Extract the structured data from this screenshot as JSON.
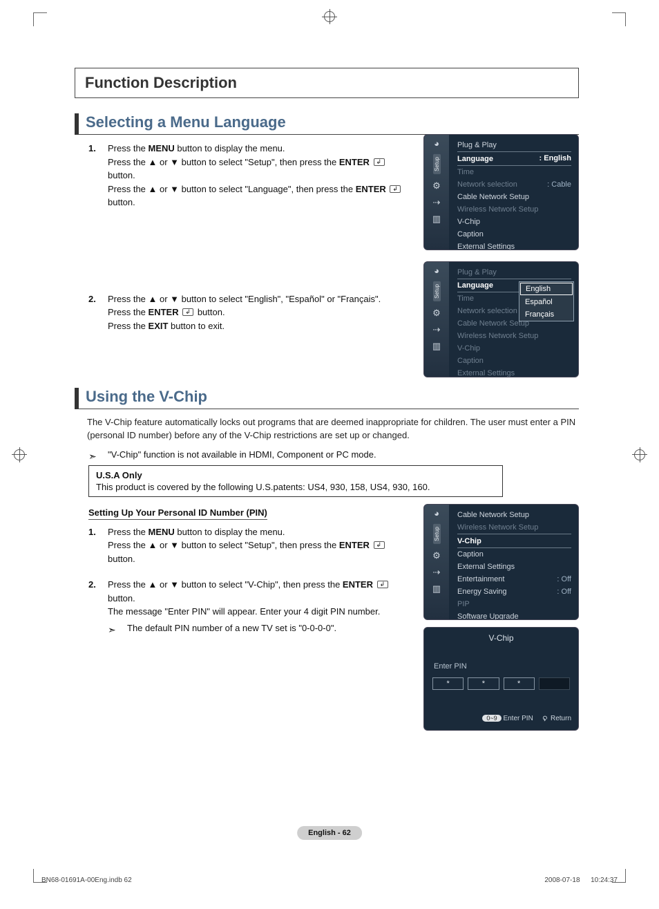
{
  "meta": {
    "title": "Function Description",
    "page_badge": "English - 62",
    "footer_left": "BN68-01691A-00Eng.indb   62",
    "footer_right": "2008-07-18      10:24:37"
  },
  "s1": {
    "heading": "Selecting a Menu Language",
    "steps": [
      {
        "n": "1.",
        "l1a": "Press the ",
        "l1b": "MENU",
        "l1c": " button to display the menu.",
        "l2a": "Press the ▲ or ▼ button to select \"Setup\", then press the ",
        "l2b": "ENTER",
        "l2c": " button.",
        "l3a": "Press the ▲ or ▼ button to select \"Language\", then press the ",
        "l3b": "ENTER",
        "l3c": " button."
      },
      {
        "n": "2.",
        "l1a": "Press the ▲ or ▼ button to select \"English\", \"Español\" or \"Français\".",
        "l2a": "Press the ",
        "l2b": "ENTER",
        "l2c": " button.",
        "l3a": "Press the ",
        "l3b": "EXIT",
        "l3c": " button to exit."
      }
    ],
    "osd1": {
      "side_label": "Setup",
      "items": [
        {
          "label": "Plug & Play",
          "dim": false
        },
        {
          "label": "Language",
          "val": ": English",
          "sel": true,
          "bullet": true
        },
        {
          "label": "Time",
          "dim": true
        },
        {
          "label": "Network selection",
          "val": ": Cable",
          "dim": true
        },
        {
          "label": "Cable Network Setup",
          "dim": false
        },
        {
          "label": "Wireless Network Setup",
          "dim": true
        },
        {
          "label": "V-Chip",
          "dim": false
        },
        {
          "label": "Caption",
          "dim": false
        },
        {
          "label": "External Settings",
          "dim": false
        }
      ]
    },
    "osd2": {
      "side_label": "Setup",
      "items": [
        {
          "label": "Plug & Play",
          "dim": true
        },
        {
          "label": "Language",
          "val": ":",
          "sel": true
        },
        {
          "label": "Time",
          "dim": true
        },
        {
          "label": "Network selection",
          "dim": true
        },
        {
          "label": "Cable Network Setup",
          "dim": true
        },
        {
          "label": "Wireless Network Setup",
          "dim": true
        },
        {
          "label": "V-Chip",
          "dim": true
        },
        {
          "label": "Caption",
          "dim": true
        },
        {
          "label": "External Settings",
          "dim": true
        }
      ],
      "popup": [
        "English",
        "Español",
        "Français"
      ],
      "popup_sel": 0
    }
  },
  "s2": {
    "heading": "Using the V-Chip",
    "intro": "The V-Chip feature automatically locks out programs that are deemed inappropriate for children. The user must enter a PIN (personal ID number) before any of the V-Chip restrictions are set up or changed.",
    "note1": "\"V-Chip\" function is not available in HDMI, Component or PC mode.",
    "usa_title": "U.S.A Only",
    "usa_body": "This product is covered by the following U.S.patents: US4, 930, 158, US4, 930, 160.",
    "pin_heading": "Setting Up Your Personal ID Number (PIN)",
    "steps": [
      {
        "n": "1.",
        "l1a": "Press the ",
        "l1b": "MENU",
        "l1c": " button to display the menu.",
        "l2a": "Press the ▲ or ▼ button to select \"Setup\", then press the ",
        "l2b": "ENTER",
        "l2c": " button."
      },
      {
        "n": "2.",
        "l1a": "Press the ▲ or ▼ button to select \"V-Chip\", then press the ",
        "l1b": "ENTER",
        "l1c": " button.",
        "l2a": "The message \"Enter PIN\" will appear. Enter your 4 digit PIN number."
      }
    ],
    "note2": "The default PIN number of a new TV set is \"0-0-0-0\".",
    "osd3": {
      "side_label": "Setup",
      "items": [
        {
          "label": "Cable Network Setup"
        },
        {
          "label": "Wireless Network Setup",
          "dim": true
        },
        {
          "label": "V-Chip",
          "sel": true,
          "bullet": true
        },
        {
          "label": "Caption"
        },
        {
          "label": "External Settings"
        },
        {
          "label": "Entertainment",
          "val": ": Off"
        },
        {
          "label": "Energy Saving",
          "val": ": Off"
        },
        {
          "label": "PIP",
          "dim": true
        },
        {
          "label": "Software Upgrade"
        }
      ]
    },
    "pin": {
      "title": "V-Chip",
      "label": "Enter PIN",
      "cells": [
        "*",
        "*",
        "*",
        ""
      ],
      "foot_badge": "0~9",
      "foot1": "Enter PIN",
      "foot2": "Return"
    }
  }
}
